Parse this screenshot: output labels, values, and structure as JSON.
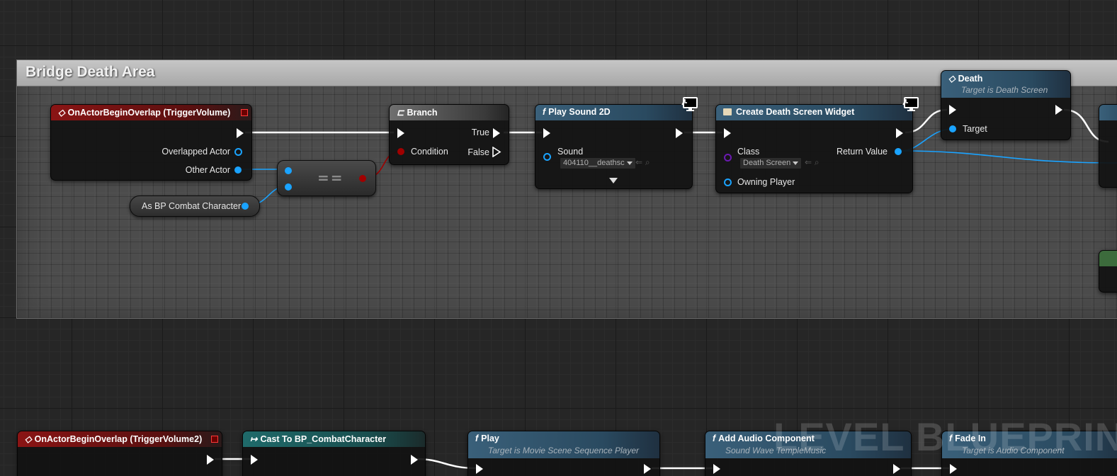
{
  "comment_box": {
    "title": "Bridge Death Area"
  },
  "nodes": {
    "on_actor_overlap": {
      "title": "OnActorBeginOverlap (TriggerVolume)",
      "pins": {
        "overlapped_actor": "Overlapped Actor",
        "other_actor": "Other Actor"
      }
    },
    "branch": {
      "title": "Branch",
      "pins": {
        "condition": "Condition",
        "true": "True",
        "false": "False"
      }
    },
    "equals": {
      "operator": "=="
    },
    "as_bp_combat": {
      "label": "As BP Combat Character"
    },
    "play_sound_2d": {
      "title": "Play Sound 2D",
      "pins": {
        "sound": "Sound"
      },
      "sound_value": "404110__deathsc"
    },
    "create_widget": {
      "title": "Create Death Screen Widget",
      "pins": {
        "class": "Class",
        "return_value": "Return Value",
        "owning_player": "Owning Player"
      },
      "class_value": "Death Screen"
    },
    "death": {
      "title": "Death",
      "subtitle": "Target is Death Screen",
      "pins": {
        "target": "Target"
      }
    },
    "on_actor_overlap2": {
      "title": "OnActorBeginOverlap (TriggerVolume2)"
    },
    "cast_to": {
      "title": "Cast To BP_CombatCharacter"
    },
    "play": {
      "title": "Play",
      "subtitle": "Target is Movie Scene Sequence Player"
    },
    "add_audio": {
      "title": "Add Audio Component",
      "subtitle": "Sound Wave TempleMusic"
    },
    "fade_in": {
      "title": "Fade In",
      "subtitle": "Target is Audio Component"
    }
  },
  "watermark": "LEVEL BLUEPRINT",
  "colors": {
    "event_header": "#8a1414",
    "function_header": "#3a607a",
    "cast_header": "#1f6a6a",
    "object_pin": "#1aa3ff",
    "bool_pin": "#a00000",
    "class_pin": "#6a1ab0",
    "exec_wire": "#ffffff"
  },
  "icons": {
    "event": "event-diamond-icon",
    "function": "function-f-icon",
    "branch": "branch-icon",
    "widget": "widget-icon",
    "latent": "monitor-icon"
  }
}
